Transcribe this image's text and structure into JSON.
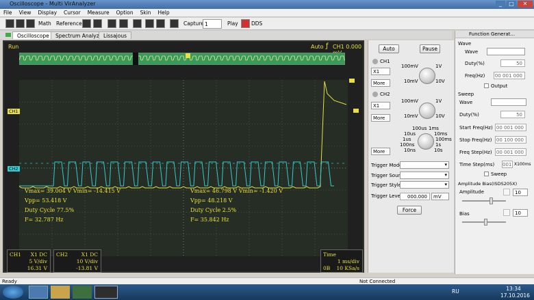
{
  "window": {
    "title": "Oscilloscope - Multi VirAnalyzer"
  },
  "menu": [
    "File",
    "View",
    "Display",
    "Cursor",
    "Measure",
    "Option",
    "Skin",
    "Help"
  ],
  "toolbar": {
    "math": "Math",
    "reference": "Reference",
    "capture": "Capture",
    "capture_count": "1",
    "play": "Play",
    "dds": "DDS"
  },
  "tabs": [
    "Oscilloscope",
    "Spectrum Analyzer",
    "Lissajous"
  ],
  "scope": {
    "run": "Run",
    "trigger_mode": "Auto",
    "trigger_text": "CH1 0.000 mV",
    "ch1_marker": "CH1",
    "ch2_marker": "CH2",
    "trig_marker": "T",
    "ch1_meas": {
      "vmax_vmin": "Vmax= 39.004 V  Vmin= -14.415 V",
      "vpp": "Vpp= 53.418 V",
      "duty": "Duty Cycle 77.5%",
      "freq": "F= 32.787 Hz"
    },
    "ch2_meas": {
      "vmax_vmin": "Vmax= 46.798 V  Vmin= -1.420 V",
      "vpp": "Vpp= 48.218 V",
      "duty": "Duty Cycle 2.5%",
      "freq": "F= 35.842 Hz"
    },
    "ch1_panel": {
      "name": "CH1",
      "coupling": "X1  DC",
      "vdiv": "5 V/div",
      "offset": "16.31 V"
    },
    "ch2_panel": {
      "name": "CH2",
      "coupling": "X1  DC",
      "vdiv": "10 V/div",
      "offset": "-13.81 V"
    },
    "time_panel": {
      "label": "Time",
      "tdiv": "1 ms/div",
      "zero": "0B",
      "rate": "10 KSa/s"
    }
  },
  "controls": {
    "auto": "Auto",
    "pause": "Pause",
    "ch1": {
      "label": "CH1",
      "probe": "X1",
      "more": "More",
      "k_min": "10mV",
      "k_mid": "100mV",
      "k_r1": "1V",
      "k_r2": "10V"
    },
    "ch2": {
      "label": "CH2",
      "probe": "X1",
      "more": "More",
      "k_min": "10mV",
      "k_mid": "100mV",
      "k_r1": "1V",
      "k_r2": "10V"
    },
    "time": {
      "more": "More",
      "t1": "100us",
      "t2": "1ms",
      "t3": "10us",
      "t4": "10ms",
      "t5": "1us",
      "t6": "100ms",
      "t7": "100ns",
      "t8": "1s",
      "t9": "10ns",
      "t10": "10s"
    },
    "trigger_mode": "Trigger Mode",
    "trigger_source": "Trigger Source",
    "trigger_style": "Trigger Style",
    "trigger_level": "Trigger Level",
    "trigger_level_value": "000.000",
    "trigger_level_unit": "mV",
    "force": "Force"
  },
  "funcgen": {
    "title": "Function Generat...",
    "wave_section": "Wave",
    "wave": "Wave",
    "duty": "Duty(%)",
    "duty_val": "50",
    "freq": "Freq(Hz)",
    "freq_val": "00 001 000",
    "output": "Output",
    "sweep_section": "Sweep",
    "s_wave": "Wave",
    "s_duty": "Duty(%)",
    "s_duty_val": "50",
    "start_freq": "Start Freq(Hz)",
    "start_val": "00 001 000",
    "stop_freq": "Stop Freq(Hz)",
    "stop_val": "00 100 000",
    "freq_step": "Freq Step(Hz)",
    "step_val": "00 001 000",
    "time_step": "Time Step(ms)",
    "time_step_val": "001",
    "time_step_unit": "X100ms",
    "sweep_chk": "Sweep",
    "amp_bias": "Amplitude Bias(ISDS205X)",
    "amplitude": "Amplitude",
    "amp_val": "10",
    "bias": "Bias",
    "bias_val": "10"
  },
  "status": {
    "left": "Ready",
    "mid": "Not Connected"
  },
  "taskbar": {
    "lang": "RU",
    "time": "13:34",
    "date": "17.10.2016"
  }
}
